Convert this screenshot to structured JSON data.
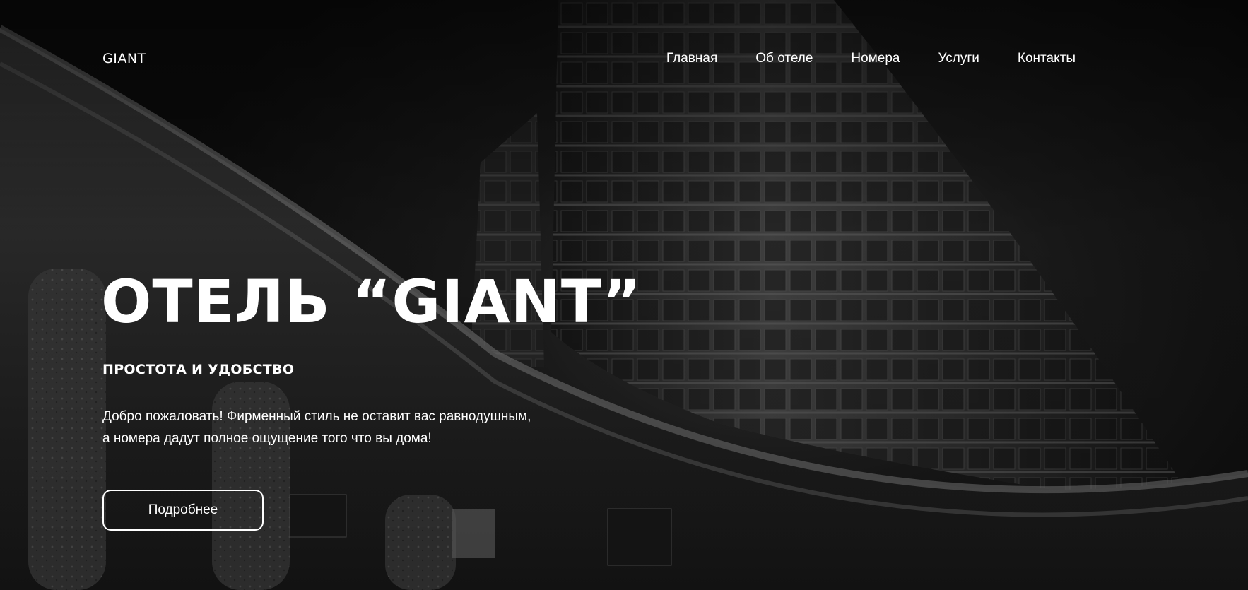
{
  "header": {
    "logo": "GIANT",
    "nav": [
      {
        "label": "Главная"
      },
      {
        "label": "Об отеле"
      },
      {
        "label": "Номера"
      },
      {
        "label": "Услуги"
      },
      {
        "label": "Контакты"
      }
    ]
  },
  "hero": {
    "title": "ОТЕЛЬ “GIANT”",
    "subtitle": "ПРОСТОТА И УДОБСТВО",
    "description_lines": [
      "Добро пожаловать! Фирменный стиль не оставит вас равнодушным,",
      "а номера дадут полное ощущение того что вы дома!"
    ],
    "cta_label": "Подробнее"
  },
  "colors": {
    "text": "#ffffff",
    "background": "#1a1a1a"
  }
}
